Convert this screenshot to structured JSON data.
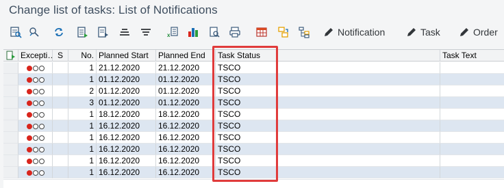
{
  "title": "Change list of tasks: List of Notifications",
  "toolbar": {
    "buttons": [
      {
        "icon": "details-icon"
      },
      {
        "icon": "select-icon"
      },
      {
        "icon": "refresh-icon"
      },
      {
        "icon": "choose-layout-icon"
      },
      {
        "icon": "save-layout-icon"
      },
      {
        "icon": "sort-ascending-icon"
      },
      {
        "icon": "filter-icon"
      },
      {
        "icon": "export-excel-icon"
      },
      {
        "icon": "chart-icon"
      },
      {
        "icon": "print-preview-icon"
      },
      {
        "icon": "print-icon"
      },
      {
        "icon": "table-icon"
      },
      {
        "icon": "transfer-icon"
      },
      {
        "icon": "hierarchy-icon"
      }
    ],
    "notification_label": "Notification",
    "task_label": "Task",
    "order_label": "Order"
  },
  "table": {
    "headers": {
      "exception": "Excepti…",
      "s": "S",
      "no": "No.",
      "planned_start": "Planned Start",
      "planned_end": "Planned End",
      "task_status": "Task Status",
      "task_text": "Task Text"
    },
    "rows": [
      {
        "no": "1",
        "planned_start": "21.12.2020",
        "planned_end": "21.12.2020",
        "task_status": "TSCO"
      },
      {
        "no": "1",
        "planned_start": "01.12.2020",
        "planned_end": "01.12.2020",
        "task_status": "TSCO"
      },
      {
        "no": "2",
        "planned_start": "01.12.2020",
        "planned_end": "01.12.2020",
        "task_status": "TSCO"
      },
      {
        "no": "3",
        "planned_start": "01.12.2020",
        "planned_end": "01.12.2020",
        "task_status": "TSCO"
      },
      {
        "no": "1",
        "planned_start": "18.12.2020",
        "planned_end": "18.12.2020",
        "task_status": "TSCO"
      },
      {
        "no": "1",
        "planned_start": "16.12.2020",
        "planned_end": "16.12.2020",
        "task_status": "TSCO"
      },
      {
        "no": "1",
        "planned_start": "16.12.2020",
        "planned_end": "16.12.2020",
        "task_status": "TSCO"
      },
      {
        "no": "1",
        "planned_start": "16.12.2020",
        "planned_end": "16.12.2020",
        "task_status": "TSCO"
      },
      {
        "no": "1",
        "planned_start": "16.12.2020",
        "planned_end": "16.12.2020",
        "task_status": "TSCO"
      },
      {
        "no": "1",
        "planned_start": "16.12.2020",
        "planned_end": "16.12.2020",
        "task_status": "TSCO"
      }
    ]
  },
  "colors": {
    "highlight": "#e03b3b",
    "row_alt": "#dde6f1",
    "status_red": "#d9251c"
  }
}
